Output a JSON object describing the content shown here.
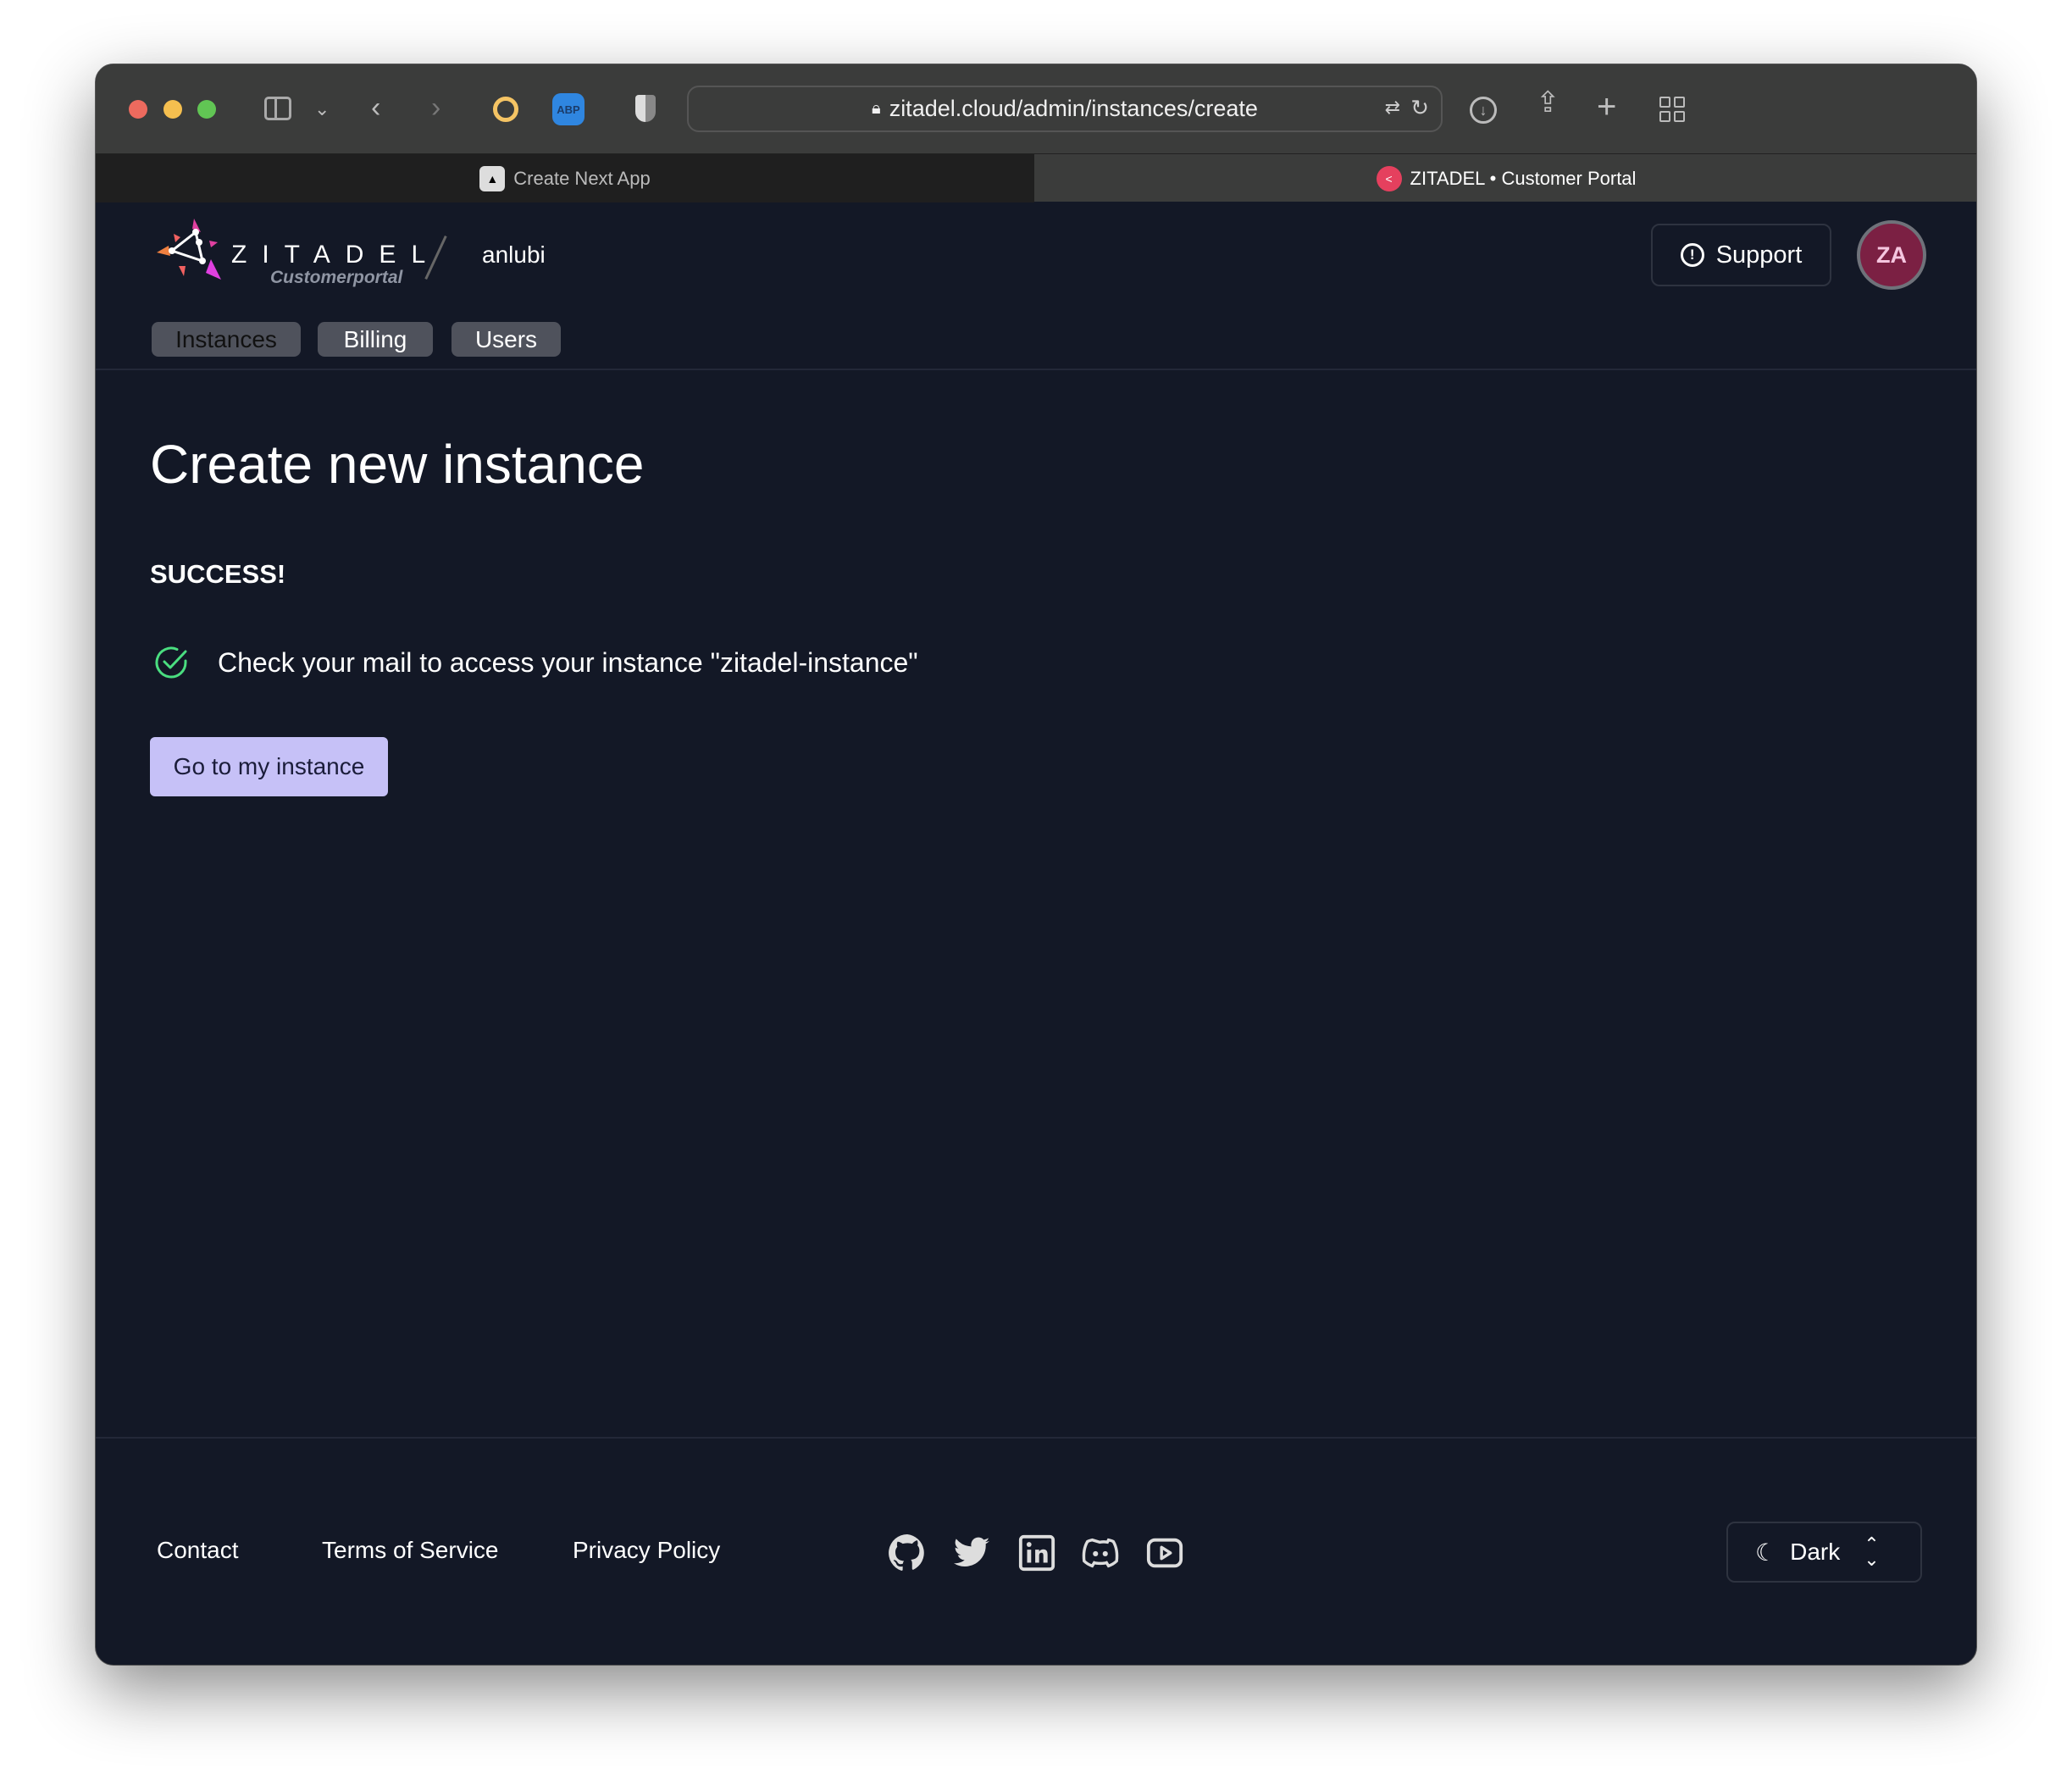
{
  "browser": {
    "url": "zitadel.cloud/admin/instances/create",
    "tabs": [
      {
        "label": "Create Next App",
        "active": false
      },
      {
        "label": "ZITADEL • Customer Portal",
        "active": true
      }
    ],
    "extension_abp": "ABP"
  },
  "header": {
    "logo_word": "ZITADEL",
    "logo_sub": "Customerportal",
    "org": "anlubi",
    "support_label": "Support",
    "avatar_initials": "ZA",
    "nav": [
      {
        "label": "Instances",
        "active": true
      },
      {
        "label": "Billing"
      },
      {
        "label": "Users"
      }
    ]
  },
  "main": {
    "title": "Create new instance",
    "status": "SUCCESS!",
    "message": "Check your mail to access your instance \"zitadel-instance\"",
    "button_label": "Go to my instance"
  },
  "footer": {
    "links": [
      "Contact",
      "Terms of Service",
      "Privacy Policy"
    ],
    "social": [
      "github-icon",
      "twitter-icon",
      "linkedin-icon",
      "discord-icon",
      "youtube-icon"
    ],
    "theme_label": "Dark"
  },
  "colors": {
    "page_bg": "#131826",
    "button_bg": "#c6c1f7",
    "avatar_bg": "#7b2043",
    "success": "#4ade80"
  }
}
